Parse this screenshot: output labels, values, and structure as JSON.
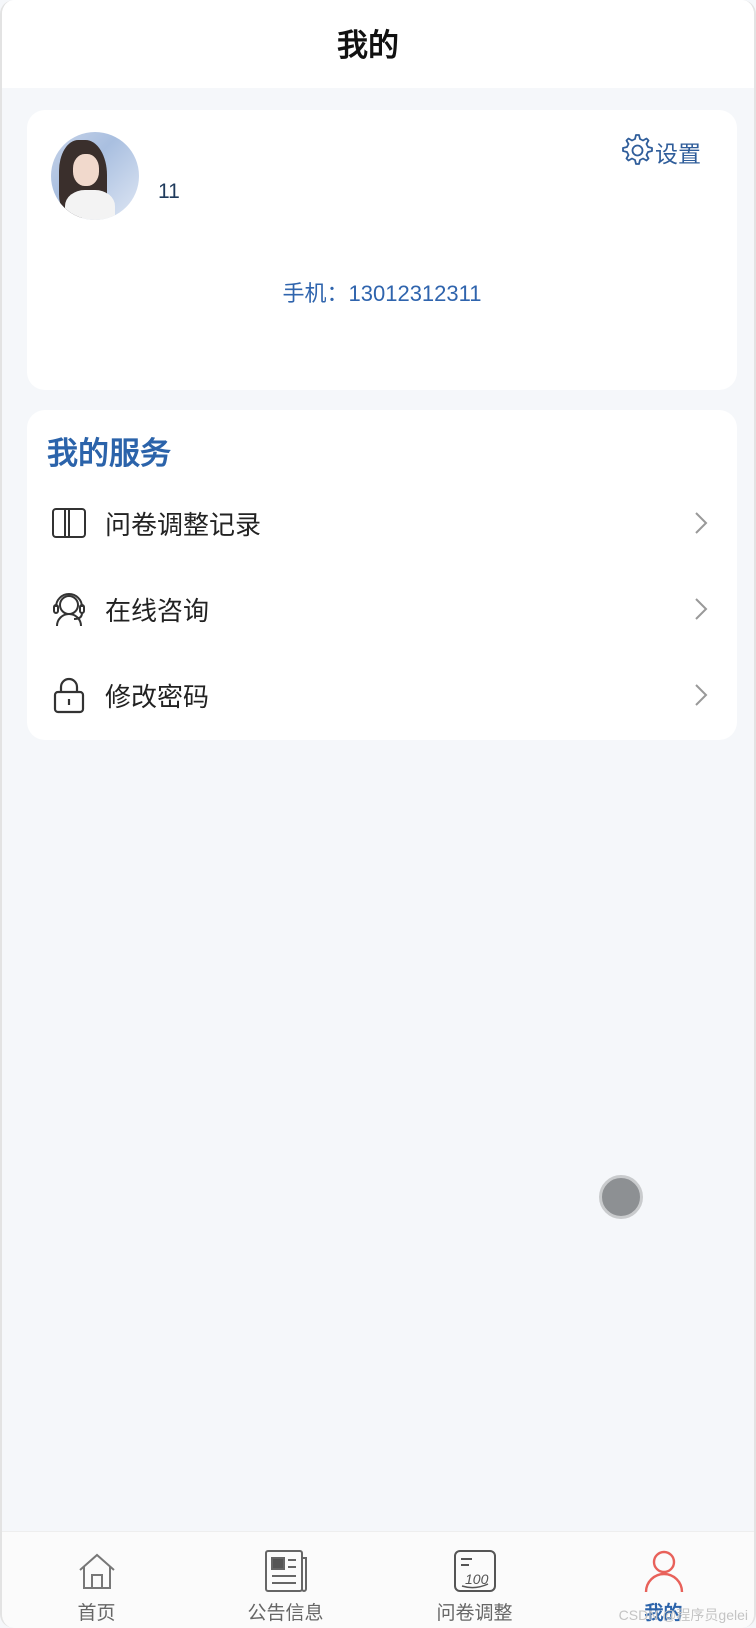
{
  "header": {
    "title": "我的"
  },
  "profile": {
    "username": "11",
    "settings_label": "设置",
    "phone_text": "手机：13012312311"
  },
  "services": {
    "title": "我的服务",
    "items": [
      {
        "label": "问卷调整记录",
        "icon": "book-icon"
      },
      {
        "label": "在线咨询",
        "icon": "headset-user-icon"
      },
      {
        "label": "修改密码",
        "icon": "lock-icon"
      }
    ]
  },
  "tabbar": {
    "items": [
      {
        "label": "首页",
        "icon": "home-icon",
        "active": false
      },
      {
        "label": "公告信息",
        "icon": "newspaper-icon",
        "active": false
      },
      {
        "label": "问卷调整",
        "icon": "exam-paper-icon",
        "active": false
      },
      {
        "label": "我的",
        "icon": "user-icon",
        "active": true
      }
    ]
  },
  "watermark": "CSDN @程序员gelei",
  "colors": {
    "accent": "#2b63aa",
    "background": "#f5f7fa",
    "active_tab_icon": "#e8615a"
  }
}
